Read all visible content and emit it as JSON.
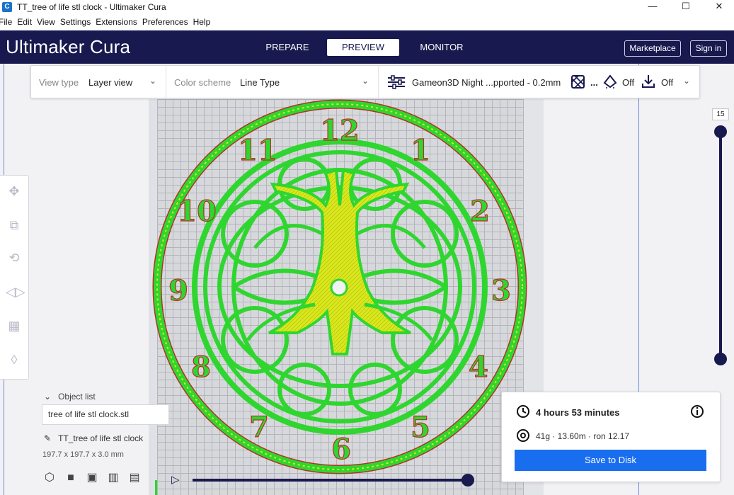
{
  "window": {
    "title": "TT_tree of life stl clock - Ultimaker Cura",
    "app_icon": "C",
    "controls": {
      "minimize": "—",
      "maximize": "☐",
      "close": "✕"
    }
  },
  "menu": {
    "items": [
      "File",
      "Edit",
      "View",
      "Settings",
      "Extensions",
      "Preferences",
      "Help"
    ]
  },
  "header": {
    "logo_bold": "Ultimaker",
    "logo_light": " Cura",
    "tabs": [
      {
        "label": "PREPARE",
        "active": false
      },
      {
        "label": "PREVIEW",
        "active": true
      },
      {
        "label": "MONITOR",
        "active": false
      }
    ],
    "marketplace_label": "Marketplace",
    "signin_label": "Sign in",
    "background_color": "#18194e"
  },
  "settings_bar": {
    "view_type_label": "View type",
    "view_type_value": "Layer view",
    "color_scheme_label": "Color scheme",
    "color_scheme_value": "Line Type",
    "profile_value": "Gameon3D Night ...pported - 0.2mm",
    "support_ellipsis": "...",
    "support_value": "Off",
    "adhesion_value": "Off"
  },
  "layer_slider": {
    "current_layer": "15"
  },
  "object_list": {
    "header": "Object list",
    "selected_object": "tree of life stl clock.stl",
    "job_name": "TT_tree of life stl clock",
    "dimensions": "197.7 x 197.7 x 3.0 mm"
  },
  "print_info": {
    "time": "4 hours 53 minutes",
    "material": "41g · 13.60m · ron 12.17",
    "save_label": "Save to Disk"
  },
  "model": {
    "numerals": [
      "12",
      "1",
      "2",
      "3",
      "4",
      "5",
      "6",
      "7",
      "8",
      "9",
      "10",
      "11"
    ],
    "fill_color": "#d9e71c",
    "wall_color": "#2fd62f",
    "outer_color": "#b5302a"
  },
  "colors": {
    "accent": "#196ef0",
    "dark": "#18194e"
  }
}
